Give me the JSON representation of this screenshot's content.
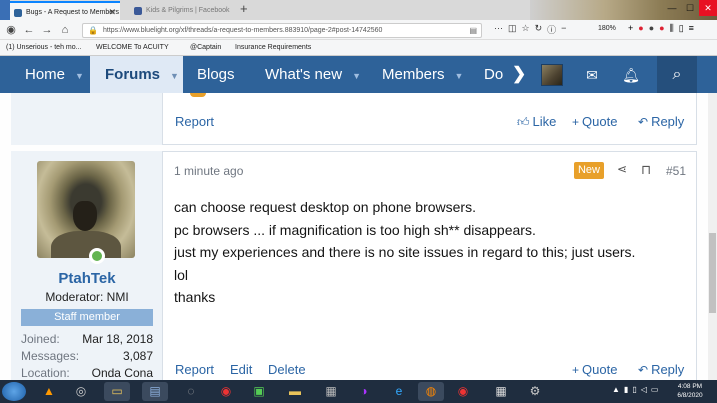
{
  "browser": {
    "tabs": [
      {
        "title": "Bugs - A Request to Members",
        "active": true
      },
      {
        "title": "Kids & Pilgrims | Facebook",
        "active": false
      }
    ],
    "new_tab": "+",
    "url": "https://www.bluelight.org/xf/threads/a-request-to-members.883910/page-2#post-14742560",
    "url_menu": "···",
    "zoom": "180%",
    "bookmarks": [
      "(1) Unserious - teh mo...",
      "WELCOME To ACUITY",
      "@Captain",
      "Insurance Requirements"
    ]
  },
  "forum_nav": {
    "items": [
      "Home",
      "Forums",
      "Blogs",
      "What's new",
      "Members",
      "Do"
    ],
    "selected": "Forums"
  },
  "prev_post": {
    "report": "Report",
    "like": "Like",
    "quote": "Quote",
    "reply": "Reply"
  },
  "post": {
    "time": "1 minute ago",
    "badge": "New",
    "number": "#51",
    "lines": [
      "can choose request desktop on phone browsers.",
      "pc browsers ... if magnification is too high sh** disappears.",
      "just my experiences and there is no site issues in regard to this; just users.",
      "lol",
      "thanks"
    ],
    "actions": {
      "report": "Report",
      "edit": "Edit",
      "delete": "Delete",
      "quote": "Quote",
      "reply": "Reply"
    }
  },
  "user": {
    "name": "PtahTek",
    "title": "Moderator: NMI",
    "banner": "Staff member",
    "stats": [
      {
        "label": "Joined:",
        "value": "Mar 18, 2018"
      },
      {
        "label": "Messages:",
        "value": "3,087"
      },
      {
        "label": "Location:",
        "value": "Onda Cona"
      }
    ]
  },
  "taskbar": {
    "time": "4:08 PM",
    "date": "6/8/2020"
  },
  "colors": {
    "nav_bg": "#2e6299",
    "link": "#2b65a5",
    "badge": "#e8a02a",
    "staff_banner": "#8ab0d8",
    "online": "#63b451"
  }
}
